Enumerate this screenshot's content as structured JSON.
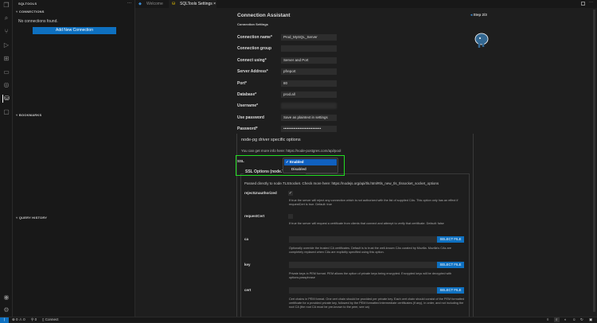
{
  "sidebar": {
    "title": "SQLTOOLS",
    "more": "···",
    "connections": "CONNECTIONS",
    "empty": "No connections found.",
    "add_button": "Add New Connection",
    "bookmarks": "BOOKMARKS",
    "history": "QUERY HISTORY"
  },
  "tabs": [
    {
      "label": "Welcome"
    },
    {
      "label": "SQLTools Settings",
      "close": "×"
    }
  ],
  "editor": {
    "title": "Connection Assistant",
    "subtitle": "Connection Settings",
    "step": "Step 2/3",
    "fields": [
      {
        "label": "Connection name*",
        "value": "Prod_MySQL_Server"
      },
      {
        "label": "Connection group",
        "value": ""
      },
      {
        "label": "Connect using*",
        "value": "Server and Port"
      },
      {
        "label": "Server Address*",
        "value": "pfreport"
      },
      {
        "label": "Port*",
        "value": "80"
      },
      {
        "label": "Database*",
        "value": "prod.all"
      },
      {
        "label": "Username*",
        "value": ""
      },
      {
        "label": "Use password",
        "value": "Save as plaintext in settings"
      },
      {
        "label": "Password*",
        "value": "••••••••••••••••••••••••••••••"
      }
    ],
    "driver_title": "node-pg driver specific options",
    "driver_info": "You can get more info here: https://node-postgres.com/api/pool",
    "ssl_label": "SSL",
    "ssl_options": [
      "Enabled",
      "Disabled"
    ],
    "ssl_selected": "Enabled",
    "ssl_legend": "SSL Options (node.TLSSocket)",
    "ssl_info": "Passed directly to node.TLSSocket. Check more here: https://nodejs.org/api/tls.html#tls_new_tls_tlssocket_socket_options",
    "reject": {
      "label": "rejectUnauthorized",
      "checked": true,
      "desc": "If true the server will reject any connection which is not authorized with the list of supplied CAs. This option only has an effect if requestCert is true. Default: true"
    },
    "request": {
      "label": "requestCert",
      "checked": false,
      "desc": "If true the server will request a certificate from clients that connect and attempt to verify that certificate. Default: false"
    },
    "ca": {
      "label": "ca",
      "button": "SELECT FILE",
      "desc": "Optionally override the trusted CA certificates. Default is to trust the well-known CAs curated by Mozilla. Mozilla's CAs are completely replaced when CAs are explicitly specified using this option."
    },
    "key": {
      "label": "key",
      "button": "SELECT FILE",
      "desc": "Private keys in PEM format. PEM allows the option of private keys being encrypted. Encrypted keys will be decrypted with options.passphrase"
    },
    "cert": {
      "label": "cert",
      "button": "SELECT FILE",
      "desc": "Cert chains in PEM format. One cert chain should be provided per private key. Each cert chain should consist of the PEM formatted certificate for a provided private key, followed by the PEM formatted intermediate certificates (if any), in order, and not including the root CA (the root CA must be pre-known to the peer, see ca)"
    }
  },
  "status": {
    "errors": "0",
    "warnings": "0",
    "ports": "0",
    "connect": "Connect"
  },
  "colors": {
    "accent": "#0e70c0",
    "highlight": "#22dd22"
  }
}
